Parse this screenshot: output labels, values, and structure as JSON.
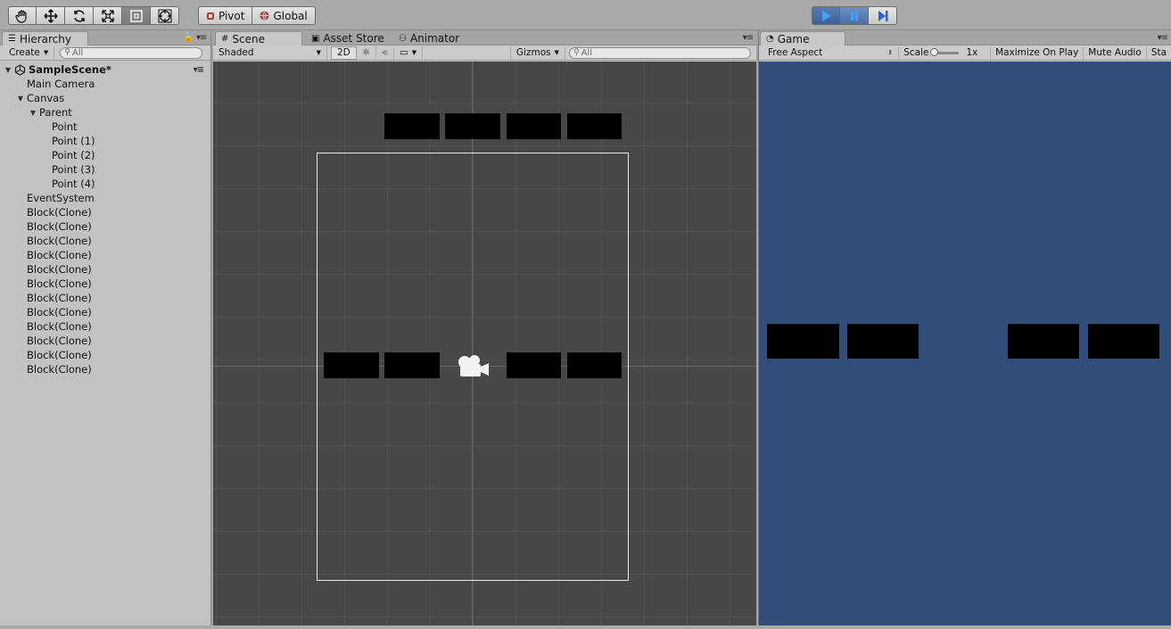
{
  "toolbar": {
    "tools": [
      {
        "name": "hand-tool",
        "icon": "hand-icon"
      },
      {
        "name": "move-tool",
        "icon": "move-arrows-icon"
      },
      {
        "name": "rotate-tool",
        "icon": "rotate-icon"
      },
      {
        "name": "scale-tool",
        "icon": "scale-icon"
      },
      {
        "name": "rect-tool",
        "icon": "rect-icon"
      },
      {
        "name": "transform-tool",
        "icon": "transform-icon"
      }
    ],
    "active_tool": "rect-tool",
    "pivot_label": "Pivot",
    "global_label": "Global",
    "play_state": "playing",
    "accent": "#4d6fa6"
  },
  "hierarchy": {
    "tab_label": "Hierarchy",
    "create_label": "Create",
    "search_placeholder": "All",
    "scene_name": "SampleScene*",
    "items": [
      {
        "label": "Main Camera",
        "depth": 1,
        "fold": ""
      },
      {
        "label": "Canvas",
        "depth": 1,
        "fold": "▼"
      },
      {
        "label": "Parent",
        "depth": 2,
        "fold": "▼"
      },
      {
        "label": "Point",
        "depth": 3,
        "fold": ""
      },
      {
        "label": "Point (1)",
        "depth": 3,
        "fold": ""
      },
      {
        "label": "Point (2)",
        "depth": 3,
        "fold": ""
      },
      {
        "label": "Point (3)",
        "depth": 3,
        "fold": ""
      },
      {
        "label": "Point (4)",
        "depth": 3,
        "fold": ""
      },
      {
        "label": "EventSystem",
        "depth": 1,
        "fold": ""
      },
      {
        "label": "Block(Clone)",
        "depth": 1,
        "fold": ""
      },
      {
        "label": "Block(Clone)",
        "depth": 1,
        "fold": ""
      },
      {
        "label": "Block(Clone)",
        "depth": 1,
        "fold": ""
      },
      {
        "label": "Block(Clone)",
        "depth": 1,
        "fold": ""
      },
      {
        "label": "Block(Clone)",
        "depth": 1,
        "fold": ""
      },
      {
        "label": "Block(Clone)",
        "depth": 1,
        "fold": ""
      },
      {
        "label": "Block(Clone)",
        "depth": 1,
        "fold": ""
      },
      {
        "label": "Block(Clone)",
        "depth": 1,
        "fold": ""
      },
      {
        "label": "Block(Clone)",
        "depth": 1,
        "fold": ""
      },
      {
        "label": "Block(Clone)",
        "depth": 1,
        "fold": ""
      },
      {
        "label": "Block(Clone)",
        "depth": 1,
        "fold": ""
      },
      {
        "label": "Block(Clone)",
        "depth": 1,
        "fold": ""
      }
    ]
  },
  "scene": {
    "tabs": [
      {
        "label": "Scene",
        "icon": "grid-icon"
      },
      {
        "label": "Asset Store",
        "icon": "store-icon"
      },
      {
        "label": "Animator",
        "icon": "animator-icon"
      }
    ],
    "shading": "Shaded",
    "mode_2d": "2D",
    "gizmos_label": "Gizmos",
    "search_placeholder": "All",
    "background": "#474747"
  },
  "game": {
    "tab_label": "Game",
    "aspect": "Free Aspect",
    "scale_label": "Scale",
    "scale_value": "1x",
    "maximize_label": "Maximize On Play",
    "mute_label": "Mute Audio",
    "stats_label": "Sta",
    "background": "#314d79"
  }
}
